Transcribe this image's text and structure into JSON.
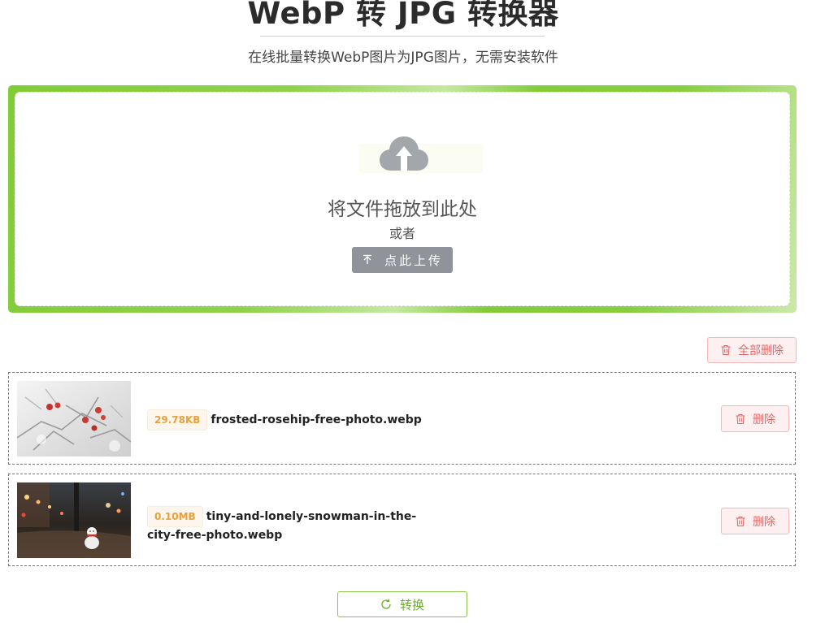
{
  "header": {
    "title": "WebP 转 JPG 转换器",
    "subtitle": "在线批量转换WebP图片为JPG图片，无需安装软件"
  },
  "dropzone": {
    "icon": "cloud-upload-icon",
    "drop_text": "将文件拖放到此处",
    "or_text": "或者",
    "upload_label": "点此上传"
  },
  "toolbar": {
    "delete_all_label": "全部删除"
  },
  "files": [
    {
      "size": "29.78KB",
      "name": "frosted-rosehip-free-photo.webp",
      "delete_label": "删除"
    },
    {
      "size": "0.10MB",
      "name_line1": "tiny-and-lonely-snowman-in-the-",
      "name_line2": "city-free-photo.webp",
      "delete_label": "删除"
    }
  ],
  "actions": {
    "convert_label": "转换"
  },
  "colors": {
    "accent": "#85cc3b",
    "danger": "#e06a6a",
    "warning": "#e6a23c",
    "upload_button": "#909399"
  }
}
